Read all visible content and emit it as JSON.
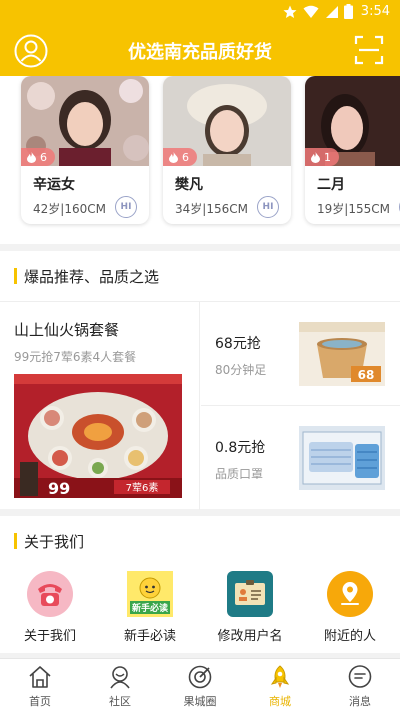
{
  "status_bar": {
    "time": "3:54"
  },
  "app_bar": {
    "title": "优选南充品质好货"
  },
  "profiles": [
    {
      "name": "辛运女",
      "info": "42岁|160CM",
      "likes": "6",
      "hi": "HI"
    },
    {
      "name": "樊凡",
      "info": "34岁|156CM",
      "likes": "6",
      "hi": "HI"
    },
    {
      "name": "二月",
      "info": "19岁|155CM",
      "likes": "1",
      "hi": "HI"
    }
  ],
  "recommend": {
    "title": "爆品推荐、品质之选",
    "featured": {
      "title": "山上仙火锅套餐",
      "subtitle": "99元抢7荤6素4人套餐",
      "image_text_price": "99",
      "image_text_tag": "7荤6素"
    },
    "items": [
      {
        "price": "68元抢",
        "desc": "80分钟足",
        "image_text": "68"
      },
      {
        "price": "0.8元抢",
        "desc": "品质口罩"
      }
    ]
  },
  "about": {
    "title": "关于我们",
    "items": [
      {
        "label": "关于我们",
        "icon": "phone-icon"
      },
      {
        "label": "新手必读",
        "icon": "guide-icon",
        "badge": "新手必读"
      },
      {
        "label": "修改用户名",
        "icon": "id-card-icon"
      },
      {
        "label": "附近的人",
        "icon": "location-icon"
      }
    ]
  },
  "tabs": [
    {
      "label": "首页",
      "icon": "home-icon",
      "active": false
    },
    {
      "label": "社区",
      "icon": "community-icon",
      "active": false
    },
    {
      "label": "果城圈",
      "icon": "circle-icon",
      "active": false
    },
    {
      "label": "商城",
      "icon": "rocket-icon",
      "active": true
    },
    {
      "label": "消息",
      "icon": "message-icon",
      "active": false
    }
  ],
  "colors": {
    "brand": "#f7c300",
    "active_tab": "#e9b400"
  }
}
